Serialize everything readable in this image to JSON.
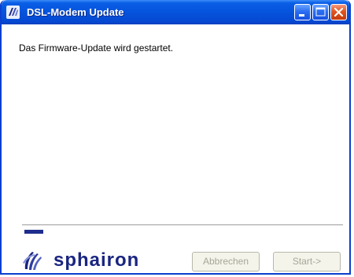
{
  "window": {
    "title": "DSL-Modem Update",
    "app_icon": "sphairon-logo-icon",
    "title_buttons": [
      "minimize-icon",
      "maximize-icon",
      "close-icon"
    ]
  },
  "content": {
    "message": "Das Firmware-Update wird gestartet."
  },
  "progress": {
    "value": 0.06,
    "color": "#1e2d8c"
  },
  "footer": {
    "brand": "sphairon",
    "logo_icon": "sphairon-swirl-icon",
    "cancel_label": "Abbrechen",
    "start_label": "Start->"
  },
  "colors": {
    "title_bar": "#0653dc",
    "brand": "#1a2580",
    "close_button": "#e2541f"
  }
}
